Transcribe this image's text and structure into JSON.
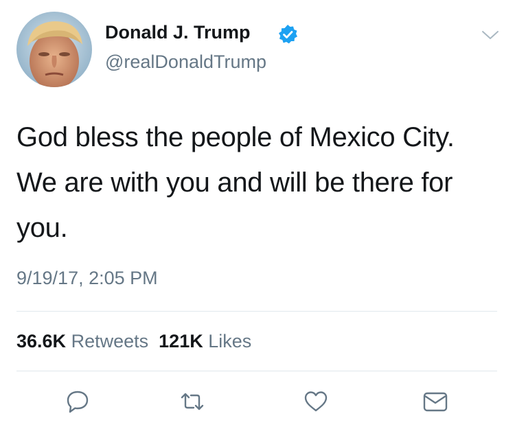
{
  "tweet": {
    "author": {
      "display_name": "Donald J. Trump",
      "handle": "@realDonaldTrump",
      "verified_icon": "verified-badge-icon"
    },
    "text": "God bless the people of Mexico City. We are with you and will be there for you.",
    "timestamp": "9/19/17, 2:05 PM",
    "stats": {
      "retweets_count": "36.6K",
      "retweets_label": "Retweets",
      "likes_count": "121K",
      "likes_label": "Likes"
    },
    "actions": [
      "reply-icon",
      "retweet-icon",
      "like-icon",
      "direct-message-icon"
    ]
  },
  "colors": {
    "text": "#14171a",
    "secondary": "#657786",
    "verified": "#1da1f2",
    "divider": "#e1e8ed",
    "icon": "#657786"
  }
}
